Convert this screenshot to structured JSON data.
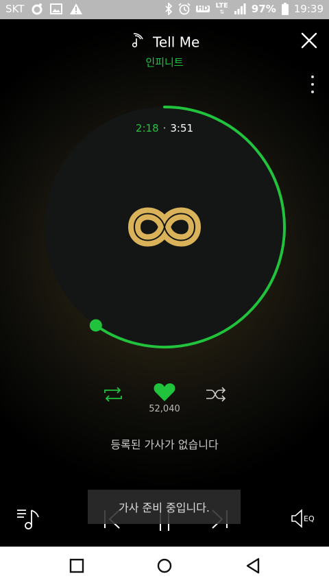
{
  "status_bar": {
    "carrier": "SKT",
    "network": "LTE",
    "hd_voice": "HD",
    "battery": "97%",
    "time": "19:39"
  },
  "player": {
    "song_title": "Tell Me",
    "artist": "인피니트",
    "time_elapsed": "2:18",
    "time_separator": "·",
    "time_total": "3:51",
    "progress_fraction": 0.597,
    "like_count": "52,040",
    "lyrics_message": "등록된 가사가 없습니다",
    "toast_message": "가사 준비 중입니다.",
    "eq_label": "EQ"
  },
  "colors": {
    "accent": "#21c33c",
    "logo_gold": "#d9b25a"
  },
  "icons": [
    "music-note-icon",
    "close-icon",
    "more-vert-icon",
    "repeat-icon",
    "heart-icon",
    "shuffle-icon",
    "playlist-icon",
    "previous-icon",
    "pause-icon",
    "next-icon",
    "speaker-eq-icon",
    "recents-icon",
    "home-icon",
    "back-icon"
  ]
}
